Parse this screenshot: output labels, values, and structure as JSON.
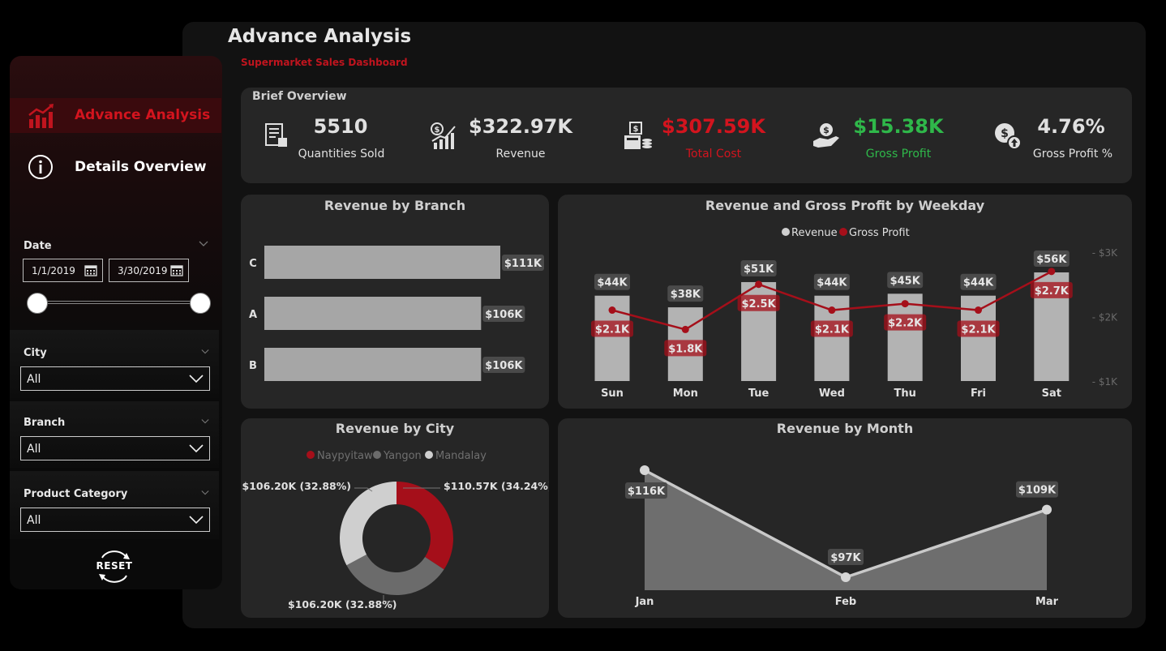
{
  "header": {
    "title": "Advance Analysis",
    "subtitle": "Supermarket Sales Dashboard"
  },
  "colors": {
    "accent_red": "#c0141e",
    "green": "#2fb84a",
    "bar_grey": "#b3b3b3",
    "line_red": "#a50f1a"
  },
  "sidebar": {
    "nav": [
      {
        "label": "Advance Analysis",
        "icon": "bar-chart-trend-icon",
        "active": true
      },
      {
        "label": "Details Overview",
        "icon": "info-circle-icon",
        "active": false
      }
    ],
    "date_filter": {
      "label": "Date",
      "start": "1/1/2019",
      "end": "3/30/2019"
    },
    "city_filter": {
      "label": "City",
      "value": "All"
    },
    "branch_filter": {
      "label": "Branch",
      "value": "All"
    },
    "category_filter": {
      "label": "Product Category",
      "value": "All"
    },
    "reset_label": "RESET"
  },
  "overview": {
    "title": "Brief Overview",
    "kpis": [
      {
        "value": "5510",
        "label": "Quantities Sold",
        "icon": "receipt-icon",
        "color": "#e0e0e0"
      },
      {
        "value": "$322.97K",
        "label": "Revenue",
        "icon": "revenue-growth-icon",
        "color": "#e0e0e0"
      },
      {
        "value": "$307.59K",
        "label": "Total Cost",
        "icon": "cost-calculator-icon",
        "color": "#d3141e"
      },
      {
        "value": "$15.38K",
        "label": "Gross Profit",
        "icon": "money-hand-icon",
        "color": "#2fb84a"
      },
      {
        "value": "4.76%",
        "label": "Gross Profit %",
        "icon": "dollar-up-icon",
        "color": "#e0e0e0"
      }
    ]
  },
  "chart_data": [
    {
      "type": "bar",
      "title": "Revenue by Branch",
      "orientation": "horizontal",
      "categories": [
        "C",
        "A",
        "B"
      ],
      "values": [
        111,
        106,
        106
      ],
      "labels": [
        "$111K",
        "$106K",
        "$106K"
      ],
      "unit": "$K"
    },
    {
      "type": "bar",
      "title": "Revenue and Gross Profit by Weekday",
      "categories": [
        "Sun",
        "Mon",
        "Tue",
        "Wed",
        "Thu",
        "Fri",
        "Sat"
      ],
      "legend": [
        "Revenue",
        "Gross Profit"
      ],
      "legend_position": "top-center",
      "series": [
        {
          "name": "Revenue",
          "type": "bar",
          "values": [
            44,
            38,
            51,
            44,
            45,
            44,
            56
          ],
          "labels": [
            "$44K",
            "$38K",
            "$51K",
            "$44K",
            "$45K",
            "$44K",
            "$56K"
          ]
        },
        {
          "name": "Gross Profit",
          "type": "line",
          "values": [
            2.1,
            1.8,
            2.5,
            2.1,
            2.2,
            2.1,
            2.7
          ],
          "labels": [
            "$2.1K",
            "$1.8K",
            "$2.5K",
            "$2.1K",
            "$2.2K",
            "$2.1K",
            "$2.7K"
          ]
        }
      ],
      "secondary_axis_ticks": [
        "$3K",
        "$2K",
        "$1K"
      ]
    },
    {
      "type": "pie",
      "title": "Revenue by City",
      "donut": true,
      "legend": [
        "Naypyitaw",
        "Yangon",
        "Mandalay"
      ],
      "legend_position": "top-center",
      "categories": [
        "Naypyitaw",
        "Yangon",
        "Mandalay"
      ],
      "values": [
        110.57,
        106.2,
        106.2
      ],
      "labels": [
        "$110.57K (34.24%)",
        "$106.20K (32.88%)",
        "$106.20K (32.88%)"
      ],
      "colors": [
        "#a50f1a",
        "#6b6b6b",
        "#cfcfcf"
      ]
    },
    {
      "type": "area",
      "title": "Revenue by Month",
      "categories": [
        "Jan",
        "Feb",
        "Mar"
      ],
      "values": [
        116,
        97,
        109
      ],
      "labels": [
        "$116K",
        "$97K",
        "$109K"
      ],
      "unit": "$K"
    }
  ]
}
